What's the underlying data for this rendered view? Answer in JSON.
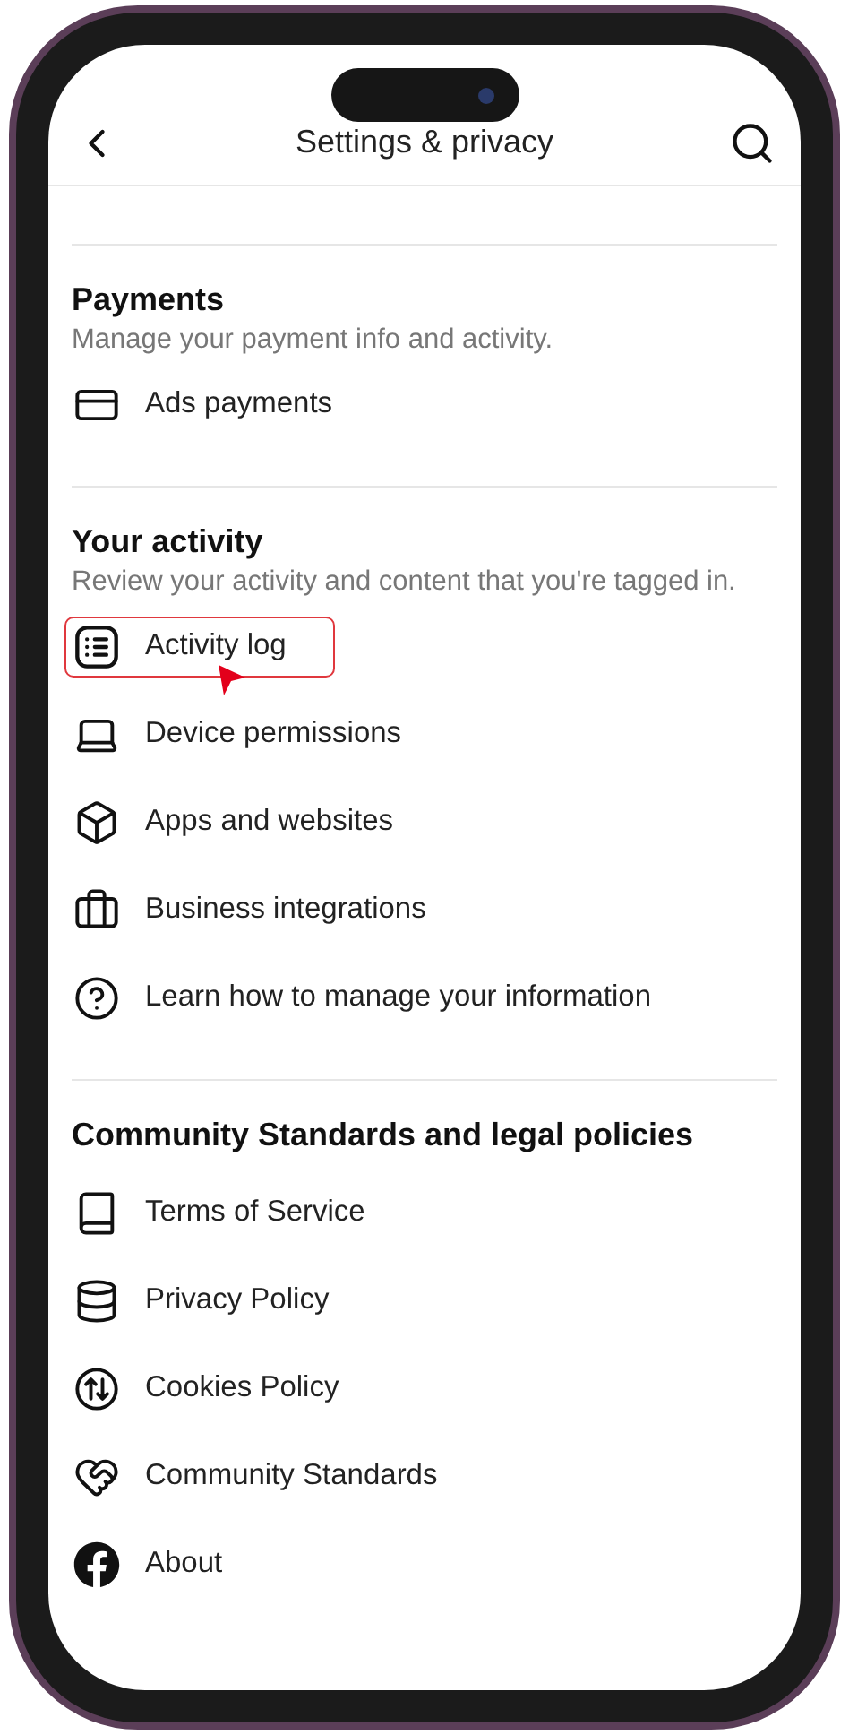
{
  "header": {
    "title": "Settings & privacy"
  },
  "sections": [
    {
      "heading": "Payments",
      "description": "Manage your payment info and activity.",
      "items": [
        {
          "label": "Ads payments",
          "highlighted": false
        }
      ]
    },
    {
      "heading": "Your activity",
      "description": "Review your activity and content that you're tagged in.",
      "items": [
        {
          "label": "Activity log",
          "highlighted": true
        },
        {
          "label": "Device permissions",
          "highlighted": false
        },
        {
          "label": "Apps and websites",
          "highlighted": false
        },
        {
          "label": "Business integrations",
          "highlighted": false
        },
        {
          "label": "Learn how to manage your information",
          "highlighted": false
        }
      ]
    },
    {
      "heading": "Community Standards and legal policies",
      "items": [
        {
          "label": "Terms of Service",
          "highlighted": false
        },
        {
          "label": "Privacy Policy",
          "highlighted": false
        },
        {
          "label": "Cookies Policy",
          "highlighted": false
        },
        {
          "label": "Community Standards",
          "highlighted": false
        },
        {
          "label": "About",
          "highlighted": false
        }
      ]
    }
  ]
}
